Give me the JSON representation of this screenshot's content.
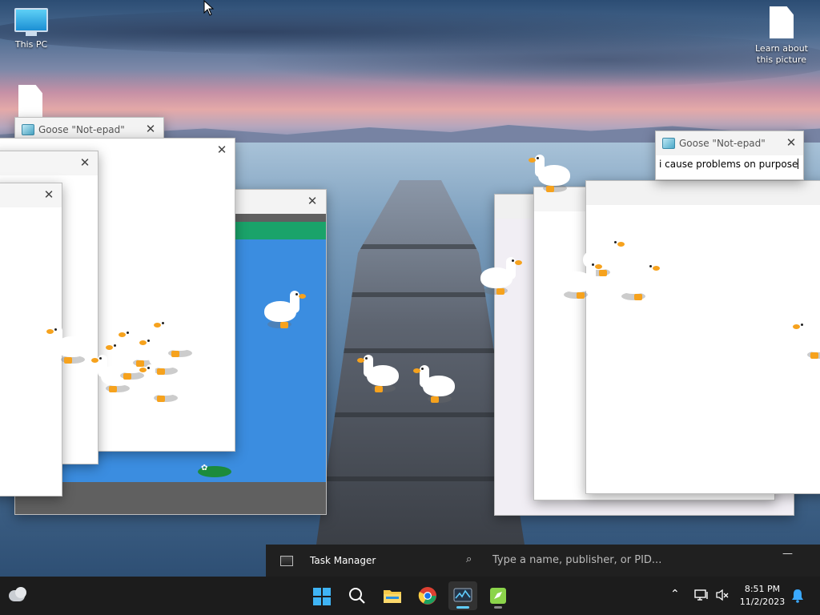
{
  "desktop": {
    "icons": [
      {
        "label": "This PC"
      },
      {
        "label": "Learn about this picture"
      }
    ]
  },
  "notepad_small": {
    "title": "Goose \"Not-epad\""
  },
  "notepad_large": {
    "title": "Goose \"Not-epad\"",
    "text": "i cause problems on purpose"
  },
  "task_manager": {
    "title": "Task Manager",
    "search_placeholder": "Type a name, publisher, or PID...",
    "minimize": "—"
  },
  "taskbar": {
    "clock_time": "8:51 PM",
    "clock_date": "11/2/2023"
  },
  "icons": {
    "close": "✕",
    "search": "⌕",
    "chevron_up": "⌃",
    "notification": "🔔"
  },
  "colors": {
    "taskbar_bg": "#1c1c1c",
    "accent": "#60cdff",
    "goose_beak": "#f6a21d"
  }
}
